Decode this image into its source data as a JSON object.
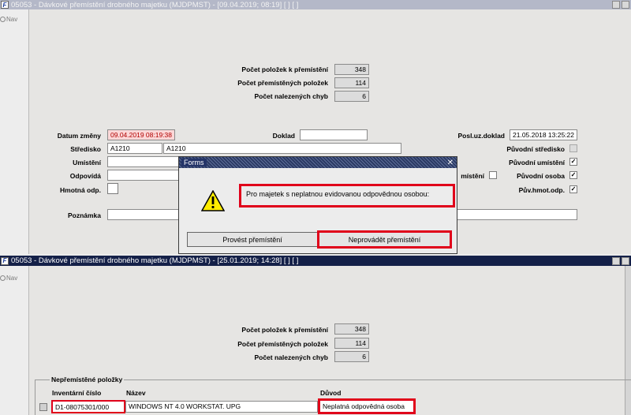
{
  "top_window": {
    "title": "05053 - Dávkové přemístění drobného majetku (MJDPMST) - [09.04.2019; 08:19]  [ ]  [ ]",
    "nav_label": "Nav",
    "stats": [
      {
        "label": "Počet položek k přemístění",
        "value": "348"
      },
      {
        "label": "Počet přemístěných položek",
        "value": "114"
      },
      {
        "label": "Počet nalezených chyb",
        "value": "6"
      }
    ],
    "fields": {
      "datum_zmeny_label": "Datum změny",
      "datum_zmeny_value": "09.04.2019 08:19:38",
      "doklad_label": "Doklad",
      "doklad_value": "",
      "posl_uz_doklad_label": "Posl.uz.doklad",
      "posl_uz_doklad_value": "21.05.2018 13:25:22",
      "stredisko_label": "Středisko",
      "stredisko_code": "A1210",
      "stredisko_name": "A1210",
      "puvodni_stredisko_label": "Původní středisko",
      "umisteni_label": "Umístění",
      "umisteni_partial_label": "místění",
      "puvodni_umisteni_label": "Původní umístění",
      "odpovida_label": "Odpovídá",
      "puvodni_osoba_label": "Původní osoba",
      "hmotna_odp_label": "Hmotná odp.",
      "puv_hmot_odp_label": "Pův.hmot.odp.",
      "poznamka_label": "Poznámka"
    }
  },
  "dialog": {
    "title": "Forms",
    "close": "✕",
    "message": "Pro majetek s neplatnou evidovanou odpovědnou osobou:",
    "button_execute": "Provést přemístění",
    "button_skip": "Neprovádět přemístění"
  },
  "bottom_window": {
    "title": "05053 - Dávkové přemístění drobného majetku (MJDPMST) - [25.01.2019; 14:28]  [ ]  [ ]",
    "nav_label": "Nav",
    "stats": [
      {
        "label": "Počet položek k přemístění",
        "value": "348"
      },
      {
        "label": "Počet přemístěných položek",
        "value": "114"
      },
      {
        "label": "Počet nalezených chyb",
        "value": "6"
      }
    ],
    "group_title": "Nepřemístěné položky",
    "columns": {
      "inv": "Inventární číslo",
      "name": "Název",
      "reason": "Důvod"
    },
    "row": {
      "inv": "D1-08075301/000",
      "name": "WINDOWS NT 4.0 WORKSTAT. UPG",
      "reason": "Neplatná odpovědná osoba"
    }
  },
  "colors": {
    "active_title": "#142048",
    "inactive_title": "#b4b8c8",
    "highlight": "#e0001a",
    "error_bg": "#fbd7d7"
  },
  "icons": [
    "forms-app-icon",
    "nav-icon",
    "warning-icon",
    "checkbox-checked-icon",
    "close-icon"
  ]
}
